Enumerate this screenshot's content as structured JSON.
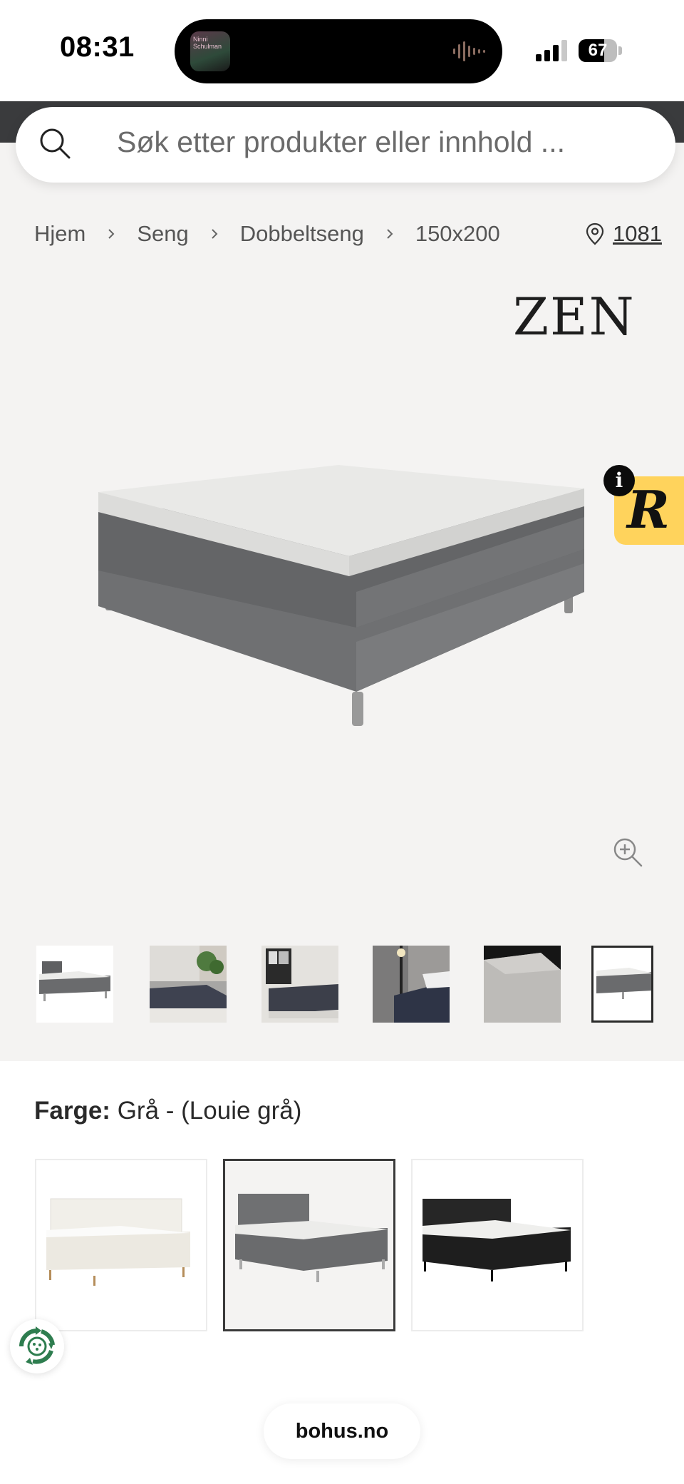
{
  "status_bar": {
    "time": "08:31",
    "battery_level": 67,
    "battery_text": "67",
    "now_playing_thumb_text": "Ninni Schulman"
  },
  "header": {
    "search_placeholder": "Søk etter produkter eller innhold ...",
    "search_icon": "search-icon"
  },
  "breadcrumb": {
    "items": [
      "Hjem",
      "Seng",
      "Dobbeltseng",
      "150x200"
    ],
    "separator_icon": "chevron-right-icon",
    "store_icon": "location-pin-icon",
    "store_label": "1081"
  },
  "product": {
    "brand": "ZEN",
    "zoom_icon": "zoom-in-icon",
    "thumbnails": [
      {
        "name": "thumb-bed-white-bg",
        "selected": false
      },
      {
        "name": "thumb-bedroom-plant",
        "selected": false
      },
      {
        "name": "thumb-bedroom-dark",
        "selected": false
      },
      {
        "name": "thumb-bed-lamp",
        "selected": false
      },
      {
        "name": "thumb-fabric-detail",
        "selected": false
      },
      {
        "name": "thumb-bed-no-headboard",
        "selected": true
      }
    ]
  },
  "color": {
    "label": "Farge:",
    "value": "Grå - (Louie grå)",
    "variants": [
      {
        "name": "white",
        "selected": false
      },
      {
        "name": "grey",
        "selected": true
      },
      {
        "name": "black",
        "selected": false
      }
    ]
  },
  "badge": {
    "letter": "R",
    "info": "i"
  },
  "footer": {
    "url": "bohus.no"
  },
  "colors": {
    "header_dark": "#3a3b3d",
    "page_bg": "#f4f3f2",
    "badge_yellow": "#ffd35c",
    "bed_grey": "#6b6c6e",
    "mattress": "#e6e6e4",
    "eco_green": "#2e7d4f"
  }
}
